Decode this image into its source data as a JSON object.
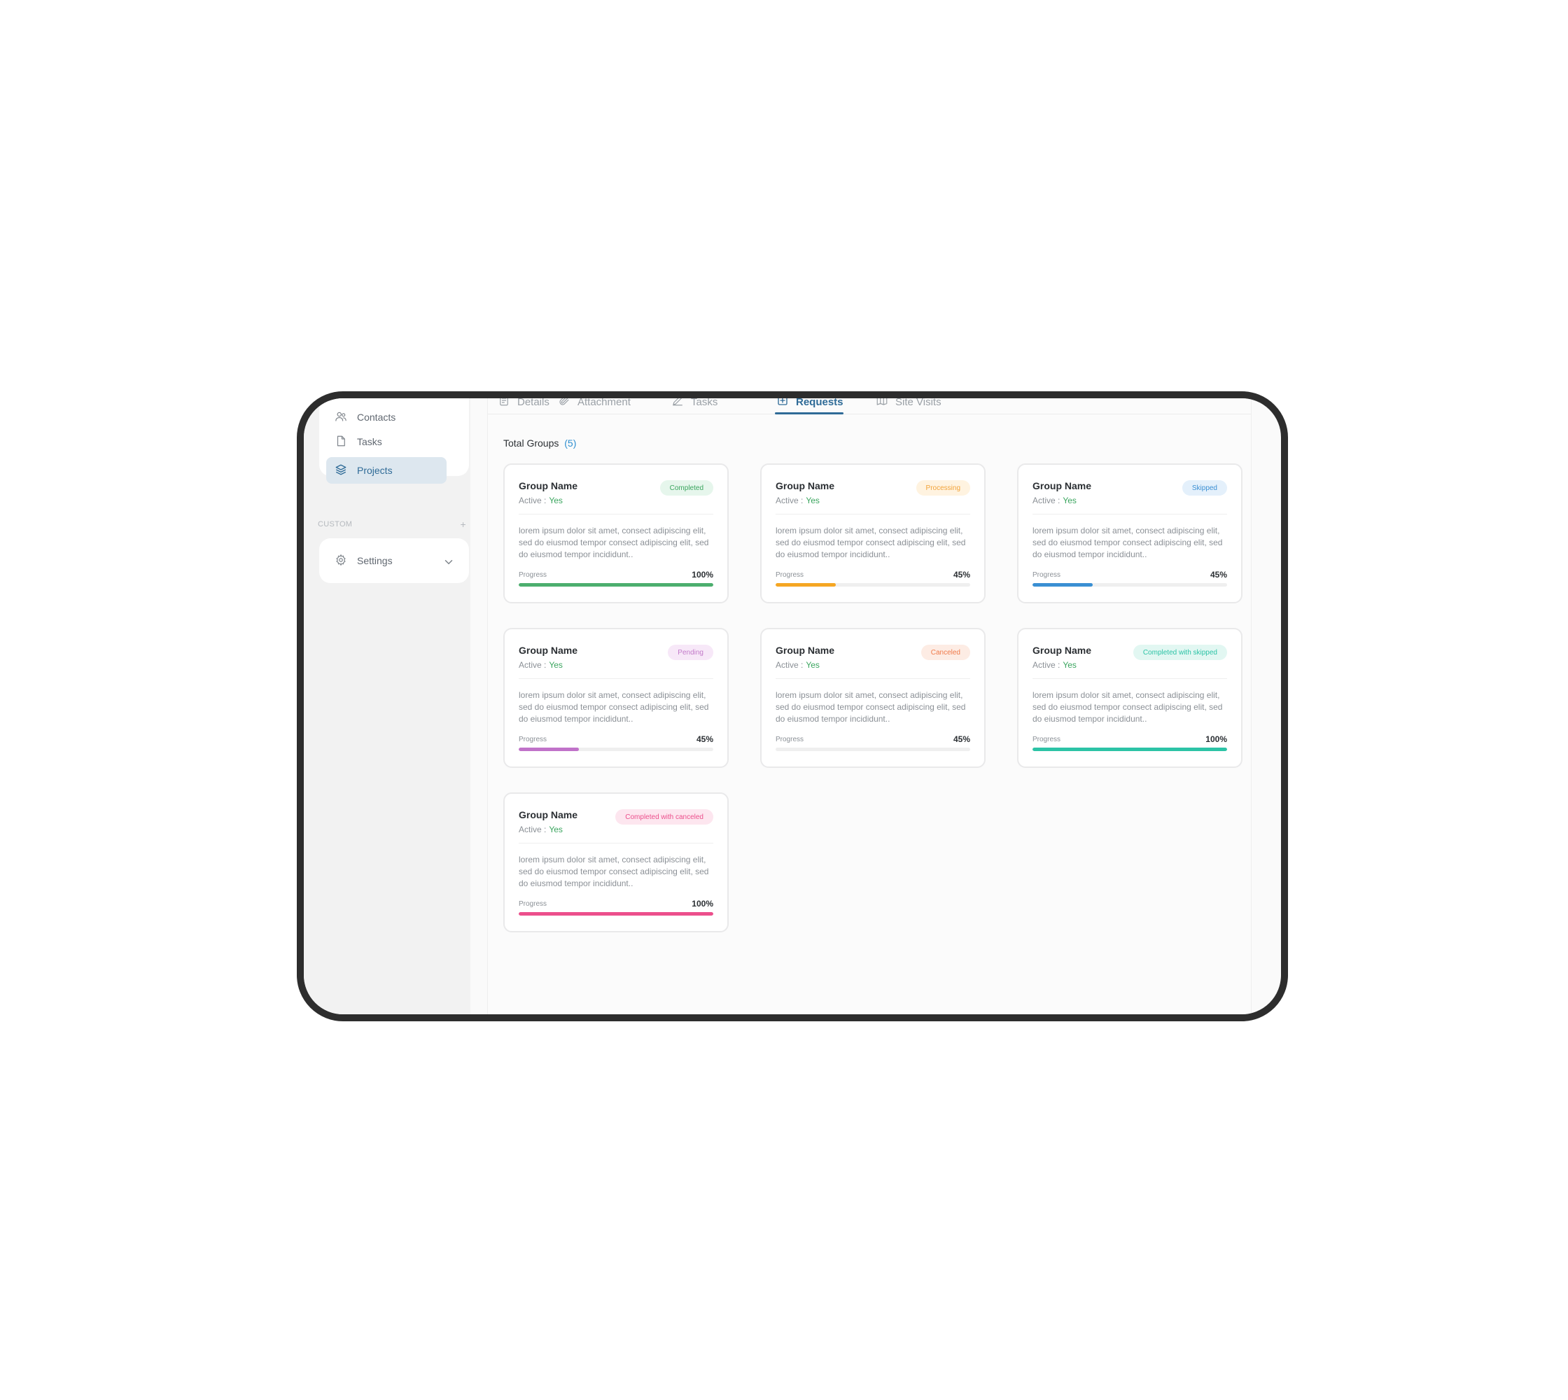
{
  "sidebar": {
    "items": [
      {
        "label": "Contacts",
        "icon": "users-icon"
      },
      {
        "label": "Tasks",
        "icon": "file-icon"
      },
      {
        "label": "Projects",
        "icon": "layers-icon",
        "active": true
      }
    ],
    "section_label": "CUSTOM",
    "section_add": "+",
    "settings_label": "Settings"
  },
  "tabs": [
    {
      "label": "Details"
    },
    {
      "label": "Attachment"
    },
    {
      "label": "Tasks"
    },
    {
      "label": "Requests",
      "active": true
    },
    {
      "label": "Site Visits"
    }
  ],
  "total": {
    "label": "Total Groups",
    "count": "(5)"
  },
  "cards": [
    {
      "title": "Group Name",
      "active_label": "Active :",
      "active_value": "Yes",
      "status": "Completed",
      "status_fg": "#3aa55e",
      "status_bg": "#e6f6ec",
      "desc": "lorem ipsum dolor sit amet, consect adipiscing elit, sed do eiusmod tempor consect adipiscing elit, sed do eiusmod tempor incididunt..",
      "progress_label": "Progress",
      "progress_text": "100%",
      "progress": 100,
      "bar_color": "#4cae6e"
    },
    {
      "title": "Group Name",
      "active_label": "Active :",
      "active_value": "Yes",
      "status": "Processing",
      "status_fg": "#f2a33a",
      "status_bg": "#fff3e0",
      "desc": "lorem ipsum dolor sit amet, consect adipiscing elit, sed do eiusmod tempor consect adipiscing elit, sed do eiusmod tempor incididunt..",
      "progress_label": "Progress",
      "progress_text": "45%",
      "progress": 31,
      "bar_color": "#f5a623"
    },
    {
      "title": "Group Name",
      "active_label": "Active :",
      "active_value": "Yes",
      "status": "Skipped",
      "status_fg": "#3b8fd3",
      "status_bg": "#e4f0fb",
      "desc": "lorem ipsum dolor sit amet, consect adipiscing elit, sed do eiusmod tempor consect adipiscing elit, sed do eiusmod tempor incididunt..",
      "progress_label": "Progress",
      "progress_text": "45%",
      "progress": 31,
      "bar_color": "#3a8fd3"
    },
    {
      "title": "Group Name",
      "active_label": "Active :",
      "active_value": "Yes",
      "status": "Pending",
      "status_fg": "#c27ac9",
      "status_bg": "#f7e8f8",
      "desc": "lorem ipsum dolor sit amet, consect adipiscing elit, sed do eiusmod tempor consect adipiscing elit, sed do eiusmod tempor incididunt..",
      "progress_label": "Progress",
      "progress_text": "45%",
      "progress": 31,
      "bar_color": "#c072c9"
    },
    {
      "title": "Group Name",
      "active_label": "Active :",
      "active_value": "Yes",
      "status": "Canceled",
      "status_fg": "#f07a4a",
      "status_bg": "#fdece4",
      "desc": "lorem ipsum dolor sit amet, consect adipiscing elit, sed do eiusmod tempor consect adipiscing elit, sed do eiusmod tempor incididunt..",
      "progress_label": "Progress",
      "progress_text": "45%",
      "progress": 0,
      "bar_color": "#f07a4a"
    },
    {
      "title": "Group Name",
      "active_label": "Active :",
      "active_value": "Yes",
      "status": "Completed with skipped",
      "status_fg": "#2cc3a6",
      "status_bg": "#e2f7f2",
      "desc": "lorem ipsum dolor sit amet, consect adipiscing elit, sed do eiusmod tempor consect adipiscing elit, sed do eiusmod tempor incididunt..",
      "progress_label": "Progress",
      "progress_text": "100%",
      "progress": 100,
      "bar_color": "#2cc3a6"
    },
    {
      "title": "Group Name",
      "active_label": "Active :",
      "active_value": "Yes",
      "status": "Completed with canceled",
      "status_fg": "#ec4f8c",
      "status_bg": "#fde6ef",
      "desc": "lorem ipsum dolor sit amet, consect adipiscing elit, sed do eiusmod tempor consect adipiscing elit, sed do eiusmod tempor incididunt..",
      "progress_label": "Progress",
      "progress_text": "100%",
      "progress": 100,
      "bar_color": "#ec4f8c"
    }
  ]
}
